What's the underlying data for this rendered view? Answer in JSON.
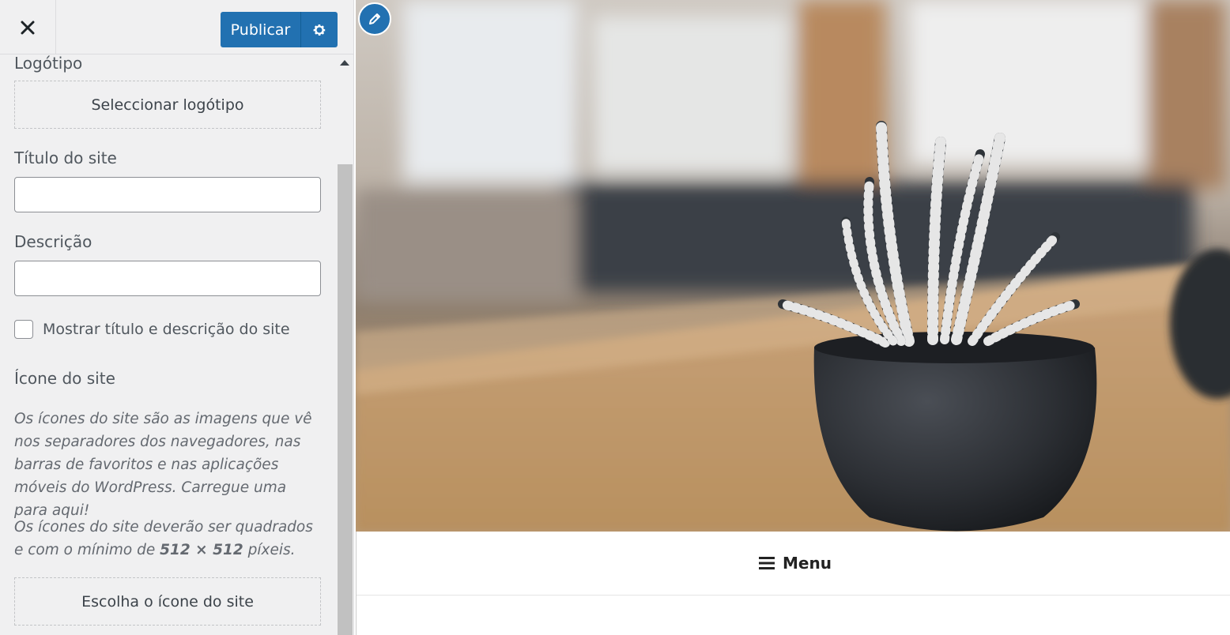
{
  "header": {
    "close_icon": "close-icon",
    "publish_label": "Publicar",
    "settings_icon": "gear-icon"
  },
  "site_identity": {
    "logo_label": "Logótipo",
    "select_logo_label": "Seleccionar logótipo",
    "site_title_label": "Título do site",
    "site_title_value": "",
    "tagline_label": "Descrição",
    "tagline_value": "",
    "display_header_text_label": "Mostrar título e descrição do site",
    "display_header_text_checked": false,
    "site_icon_label": "Ícone do site",
    "site_icon_description_1": "Os ícones do site são as imagens que vê nos separadores dos navegadores, nas barras de favoritos e nas aplicações móveis do WordPress. Carregue uma para aqui!",
    "site_icon_description_2_prefix": "Os ícones do site deverão ser quadrados e com o mínimo de ",
    "site_icon_description_2_size": "512 × 512",
    "site_icon_description_2_suffix": " píxeis.",
    "choose_site_icon_label": "Escolha o ícone do site"
  },
  "preview": {
    "edit_icon": "pencil-icon",
    "menu_label": "Menu",
    "menu_icon": "hamburger-icon"
  },
  "colors": {
    "primary": "#2271b1",
    "sidebar_bg": "#f0f0f1"
  }
}
